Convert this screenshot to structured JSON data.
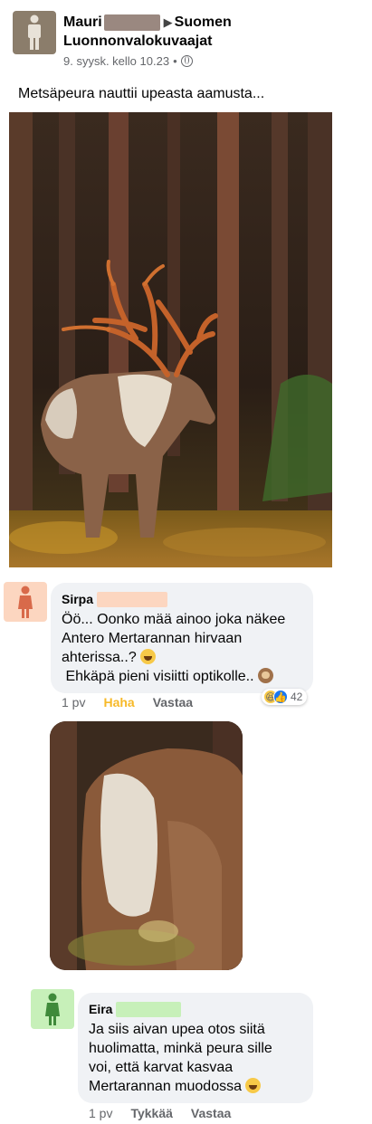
{
  "post": {
    "author_name": "Mauri",
    "group_name_line1": "Suomen",
    "group_name_line2": "Luonnonvalokuvaajat",
    "timestamp": "9. syysk. kello 10.23",
    "separator": "•",
    "caption": "Metsäpeura nauttii upeasta aamusta...",
    "avatar_color": "#8b7d6b",
    "privacy_icon": "globe-icon"
  },
  "comments": [
    {
      "name": "Sirpa",
      "avatar_color": "#fcd6c0",
      "text_lines": [
        "Öö... Oonko mää ainoo joka näkee",
        "Antero Mertarannan hirvaan",
        "ahterissa..?",
        " Ehkäpä pieni visiitti optikolle.."
      ],
      "time": "1 pv",
      "reaction_label": "Haha",
      "reply_label": "Vastaa",
      "reaction_count": "42"
    },
    {
      "name": "Eira",
      "avatar_color": "#c7f0b9",
      "text_lines": [
        "Ja siis aivan upea otos siitä",
        "huolimatta, minkä peura sille",
        "voi, että karvat kasvaa",
        "Mertarannan muodossa"
      ],
      "time": "1 pv",
      "like_label": "Tykkää",
      "reply_label": "Vastaa"
    }
  ],
  "colors": {
    "meta_text": "#65676b",
    "bubble_bg": "#f0f2f5",
    "haha_color": "#f7b928",
    "like_blue": "#1877f2"
  }
}
